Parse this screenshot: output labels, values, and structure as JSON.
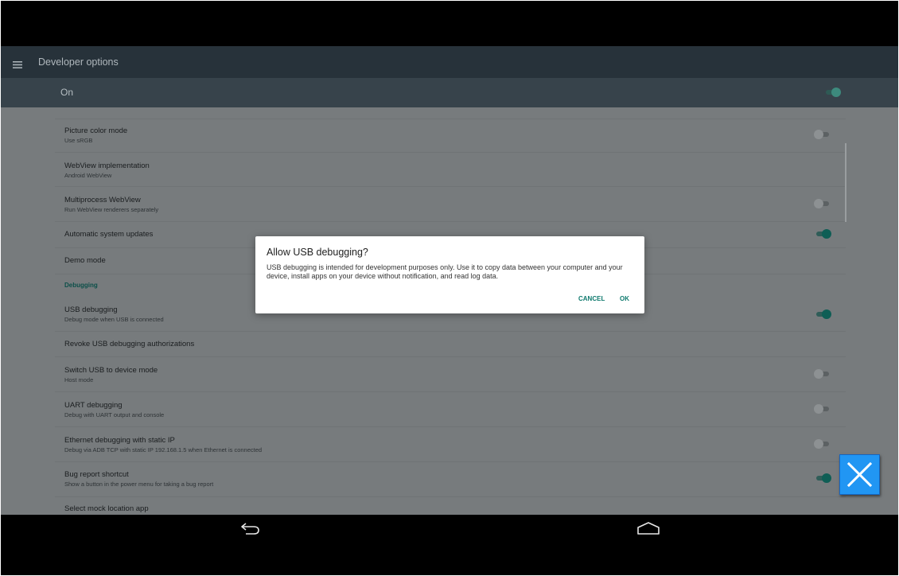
{
  "app_bar": {
    "title": "Developer options"
  },
  "master_switch": {
    "label": "On",
    "state": "on"
  },
  "dialog": {
    "title": "Allow USB debugging?",
    "message": "USB debugging is intended for development purposes only. Use it to copy data between your computer and your device, install apps on your device without notification, and read log data.",
    "cancel_label": "CANCEL",
    "ok_label": "OK"
  },
  "settings": {
    "picture_color_mode": {
      "title": "Picture color mode",
      "summary": "Use sRGB",
      "switch": "off"
    },
    "webview_impl": {
      "title": "WebView implementation",
      "summary": "Android WebView"
    },
    "multiprocess_webview": {
      "title": "Multiprocess WebView",
      "summary": "Run WebView renderers separately",
      "switch": "off"
    },
    "auto_updates": {
      "title": "Automatic system updates",
      "switch": "on"
    },
    "demo_mode": {
      "title": "Demo mode"
    },
    "debugging_header": "Debugging",
    "usb_debugging": {
      "title": "USB debugging",
      "summary": "Debug mode when USB is connected",
      "switch": "on"
    },
    "revoke_usb": {
      "title": "Revoke USB debugging authorizations"
    },
    "switch_usb_device": {
      "title": "Switch USB to device mode",
      "summary": "Host mode",
      "switch": "off"
    },
    "uart_debugging": {
      "title": "UART debugging",
      "summary": "Debug with UART output and console",
      "switch": "off"
    },
    "ethernet_debugging": {
      "title": "Ethernet debugging with static IP",
      "summary": "Debug via ADB TCP with static IP 192.168.1.5 when Ethernet is connected",
      "switch": "off"
    },
    "bug_report": {
      "title": "Bug report shortcut",
      "summary": "Show a button in the power menu for taking a bug report",
      "switch": "on"
    },
    "mock_location": {
      "title": "Select mock location app"
    }
  },
  "icons": {
    "menu": "hamburger-menu-icon",
    "back": "back-arrow-icon",
    "home": "home-icon",
    "close": "close-x-icon"
  },
  "colors": {
    "accent": "#0f7a6e",
    "app_bar": "#27323a",
    "overlay_close": "#2196f3"
  }
}
